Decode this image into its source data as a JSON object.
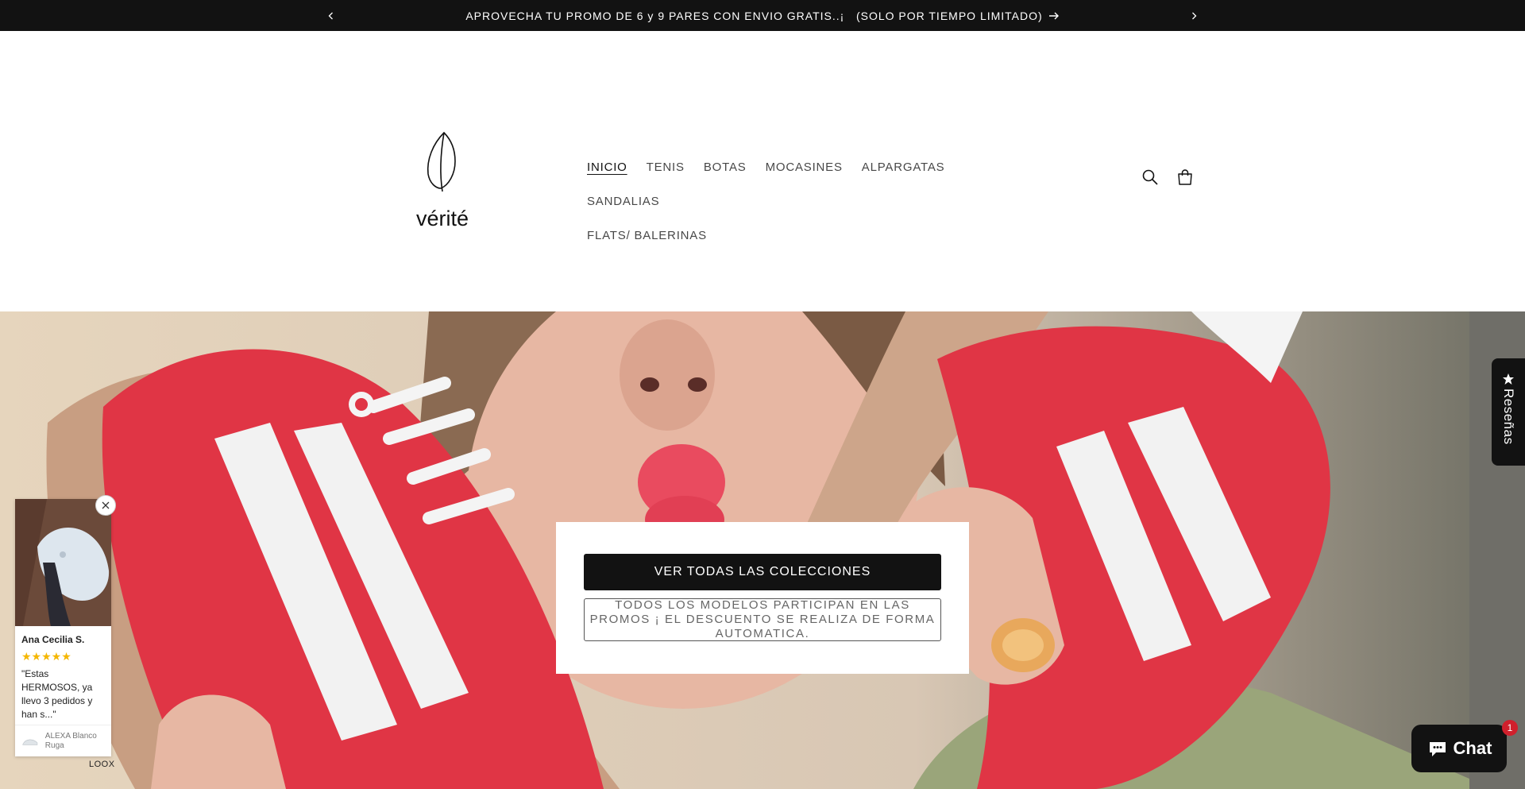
{
  "announcement": {
    "message": "APROVECHA TU PROMO DE 6 y 9 PARES CON ENVIO GRATIS..¡   (SOLO POR TIEMPO LIMITADO)"
  },
  "header": {
    "brand": "vérité",
    "nav": [
      {
        "label": "INICIO",
        "active": true
      },
      {
        "label": "TENIS"
      },
      {
        "label": "BOTAS"
      },
      {
        "label": "MOCASINES"
      },
      {
        "label": "ALPARGATAS"
      },
      {
        "label": "SANDALIAS"
      },
      {
        "label": "FLATS/ BALERINAS"
      }
    ]
  },
  "hero": {
    "primary_button": "VER TODAS LAS COLECCIONES",
    "secondary_button": "TODOS LOS MODELOS PARTICIPAN EN LAS PROMOS ¡ EL DESCUENTO SE REALIZA DE FORMA AUTOMATICA."
  },
  "reviews_tab": {
    "label": "Reseñas"
  },
  "review_popup": {
    "author": "Ana Cecilia S.",
    "stars": "★★★★★",
    "rating": 5,
    "text": "\"Estas HERMOSOS, ya llevo 3 pedidos y han s...\"",
    "product": "ALEXA Blanco Ruga",
    "branding": "LOOX"
  },
  "chat": {
    "label": "Chat",
    "badge": "1"
  },
  "colors": {
    "announcement_bg": "#121212",
    "shoe_red": "#e03545",
    "chat_badge": "#d0202c",
    "star": "#f5b700"
  }
}
